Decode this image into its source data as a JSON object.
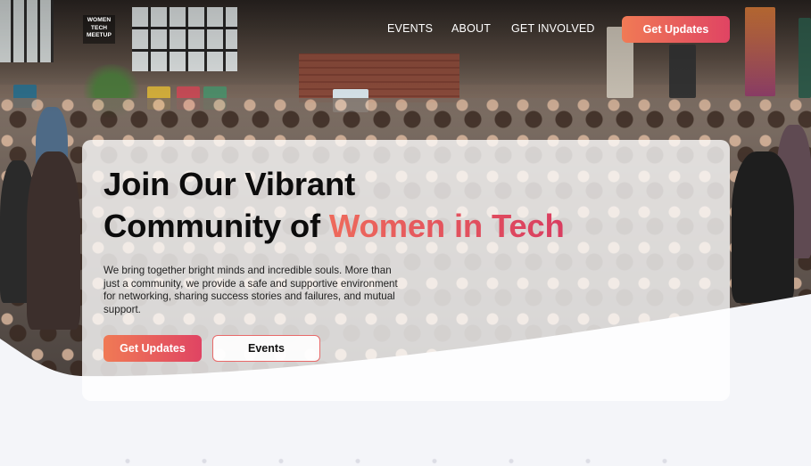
{
  "header": {
    "logo_lines": [
      "WOMEN",
      "TECH",
      "MEETUP"
    ],
    "nav": {
      "events": "EVENTS",
      "about": "ABOUT",
      "get_involved": "GET INVOLVED"
    },
    "cta_label": "Get Updates"
  },
  "hero": {
    "title_line1": "Join Our Vibrant",
    "title_line2_prefix": "Community of ",
    "title_line2_accent": "Women in Tech",
    "description": "We bring together bright minds and incredible souls. More than just a community, we provide a safe and supportive environment for networking, sharing success stories and failures, and mutual support.",
    "primary_button": "Get Updates",
    "secondary_button": "Events"
  },
  "colors": {
    "accent_start": "#f07a55",
    "accent_end": "#e04463",
    "page_background": "#f4f5f9"
  }
}
